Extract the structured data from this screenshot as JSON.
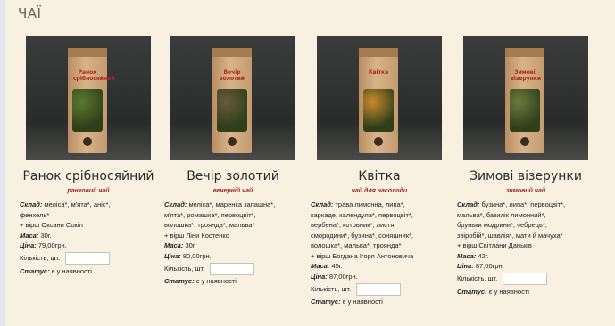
{
  "section_title": "ЧАЇ",
  "labels": {
    "composition": "Склад:",
    "mass": "Маса:",
    "price": "Ціна:",
    "quantity": "Кількість, шт.",
    "status": "Статус:"
  },
  "products": [
    {
      "name": "Ранок срібносяйний",
      "bag_text": "Ранок срібносяйний",
      "subtitle": "ранковий чай",
      "composition_lines": [
        "меліса*, м'ята*, аніс*,",
        "фенхель*",
        "+ вірш Оксани Сокіл"
      ],
      "mass": "30г.",
      "price": "79,00грн.",
      "status": "є у наявності",
      "herb_color": "#5a7a2e"
    },
    {
      "name": "Вечір золотий",
      "bag_text": "Вечір золотий",
      "subtitle": "вечерній чай",
      "composition_lines": [
        "меліса*, маренка запашна*,",
        "м'ята*, ромашка*, первоцвіт*,",
        "волошка*, троянда*, мальва*",
        "+ вірш Ліни Костенко"
      ],
      "mass": "30г.",
      "price": "80,00грн.",
      "status": "є у наявності",
      "herb_color": "#6a5a3a"
    },
    {
      "name": "Квітка",
      "bag_text": "Квітка",
      "subtitle": "чай для насолоди",
      "composition_lines": [
        "трава лимонна, липа*,",
        "каркаде, календула*, первоцвіт*,",
        "вербена*, котовник*, листя",
        "смородини*, бузина*, соняшник*,",
        "волошка*, мальва*, троянда*",
        "+ вірш Богдана Ігоря Антоновича"
      ],
      "mass": "45г.",
      "price": "87,00грн.",
      "status": "є у наявності",
      "herb_color": "#c98a2a"
    },
    {
      "name": "Зимові візерунки",
      "bag_text": "Зимові візерунки",
      "subtitle": "зимовий чай",
      "composition_lines": [
        "бузина*, липа*, первоцвіт*,",
        "мальва*, базилік лимонний*,",
        "бруньки модрини*, чебрець*,",
        "звіробій*, шавлія*, мати й мачуха*",
        "+ вірш Світлани Даньків"
      ],
      "mass": "42г.",
      "price": "87,00грн.",
      "status": "є у наявності",
      "herb_color": "#6a7b3e"
    }
  ]
}
